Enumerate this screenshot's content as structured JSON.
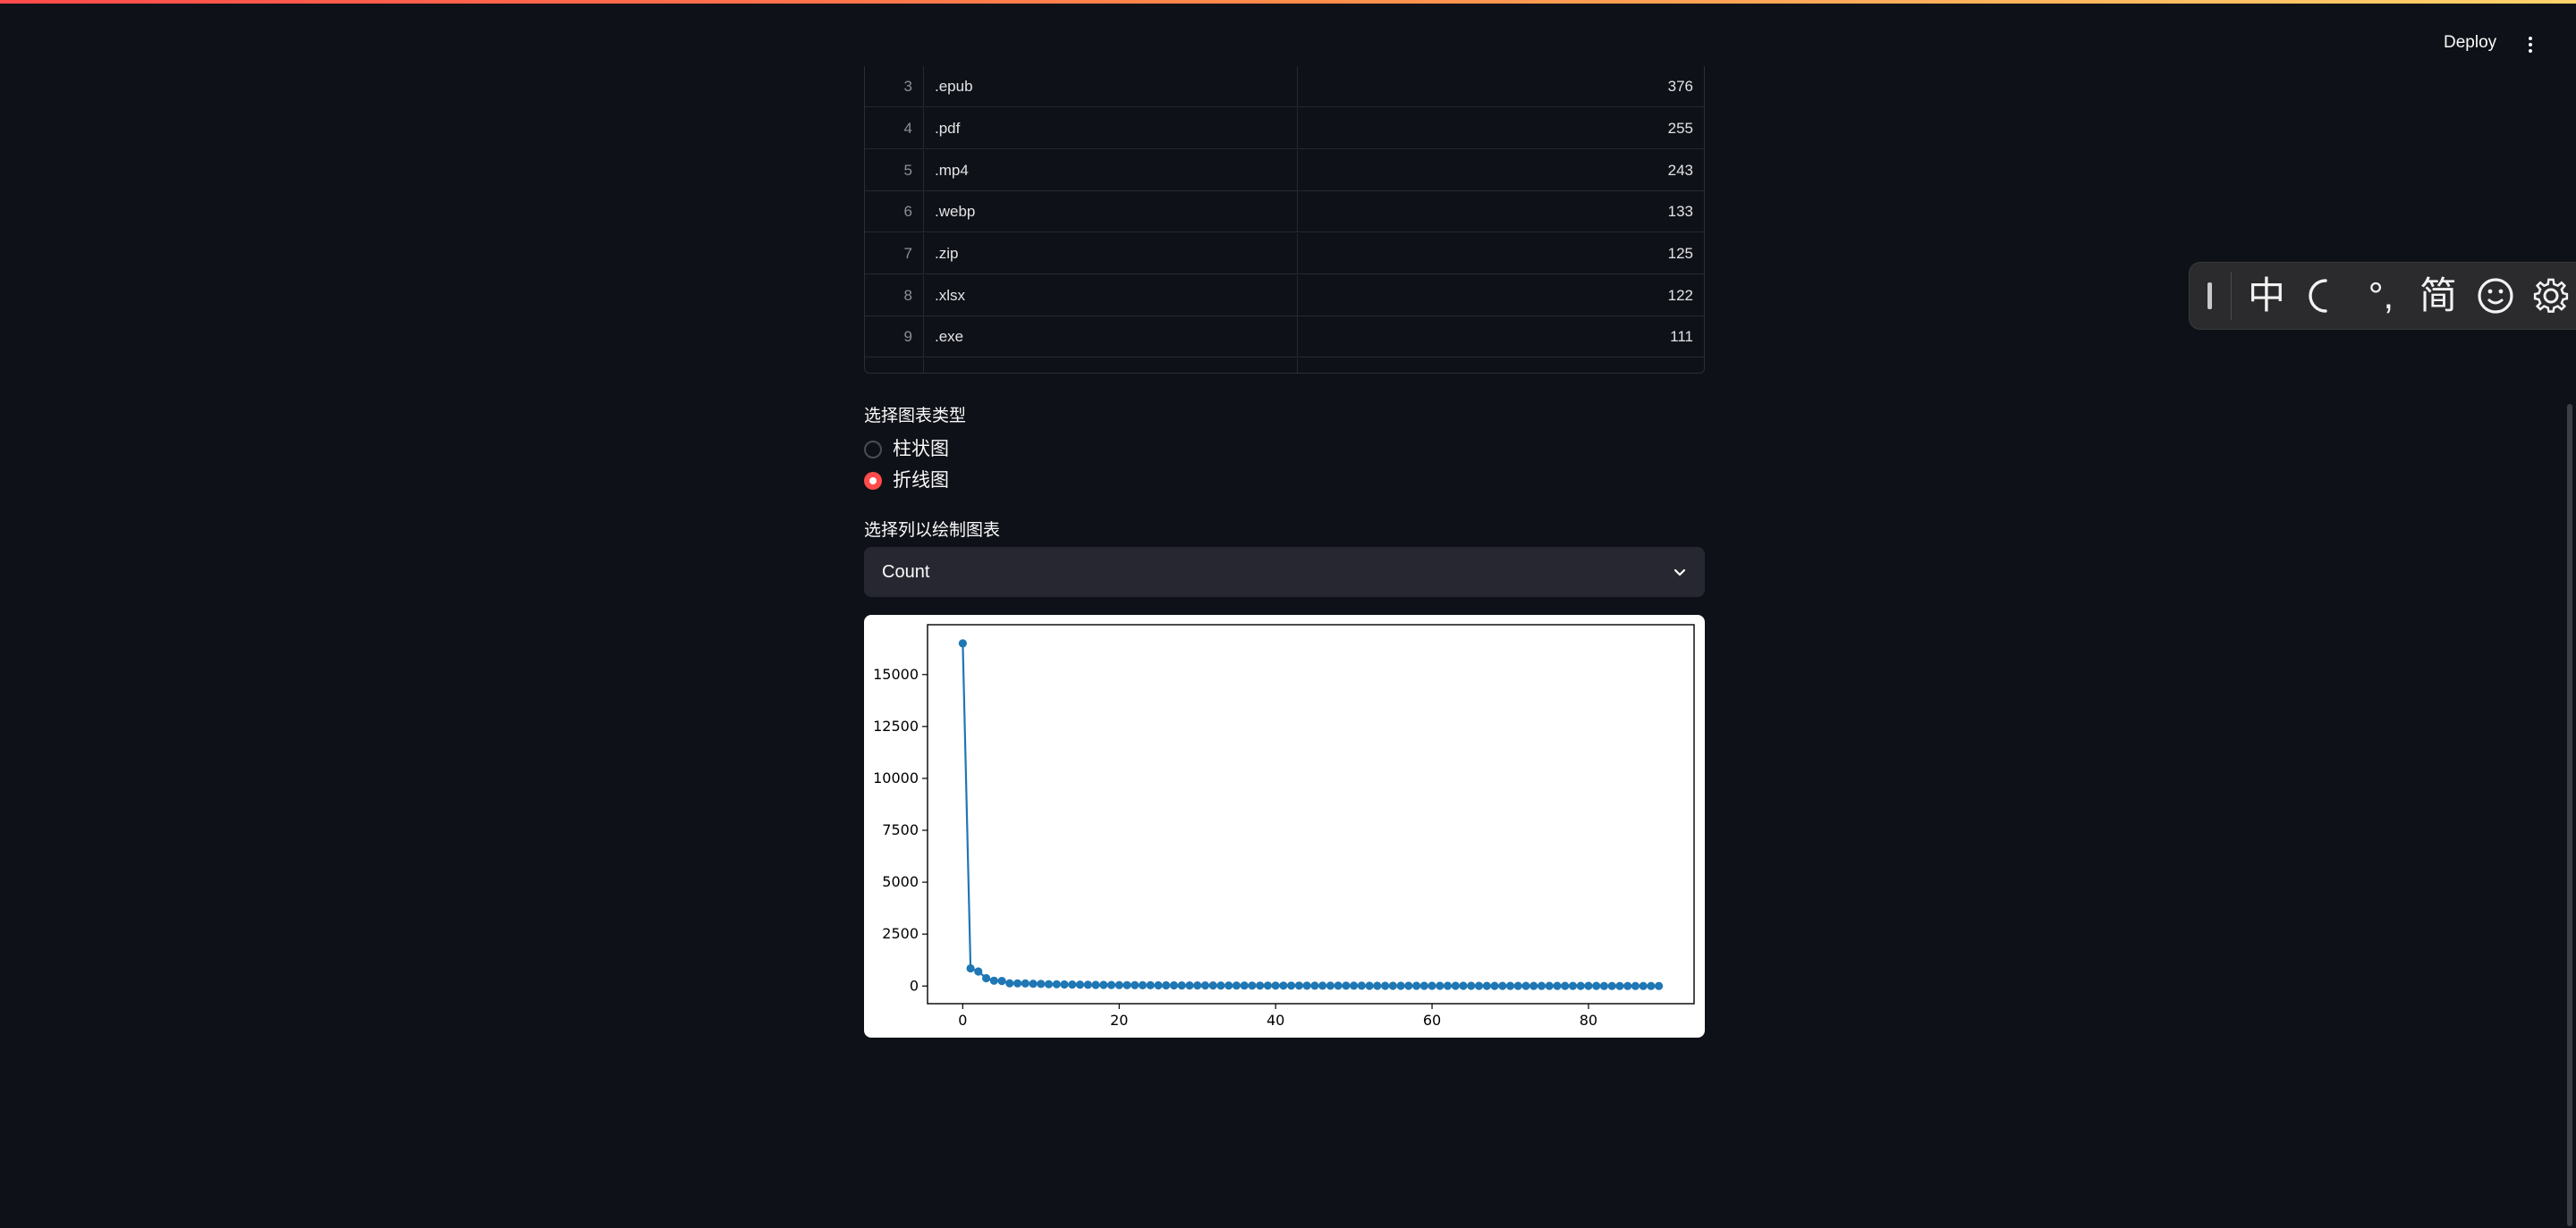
{
  "header": {
    "deploy_label": "Deploy",
    "menu_icon": "kebab-menu-icon"
  },
  "table": {
    "rows": [
      {
        "index": "3",
        "extension": ".epub",
        "count": "376"
      },
      {
        "index": "4",
        "extension": ".pdf",
        "count": "255"
      },
      {
        "index": "5",
        "extension": ".mp4",
        "count": "243"
      },
      {
        "index": "6",
        "extension": ".webp",
        "count": "133"
      },
      {
        "index": "7",
        "extension": ".zip",
        "count": "125"
      },
      {
        "index": "8",
        "extension": ".xlsx",
        "count": "122"
      },
      {
        "index": "9",
        "extension": ".exe",
        "count": "111"
      }
    ]
  },
  "chart_type_selector": {
    "label": "选择图表类型",
    "options": [
      "柱状图",
      "折线图"
    ],
    "selected": "折线图"
  },
  "column_selector": {
    "label": "选择列以绘制图表",
    "value": "Count",
    "chevron_icon": "chevron-down-icon"
  },
  "chart_data": {
    "type": "line",
    "title": "",
    "xlabel": "",
    "ylabel": "",
    "xlim": [
      -4.5,
      93.5
    ],
    "ylim": [
      -850,
      17400
    ],
    "xticks": [
      "0",
      "20",
      "40",
      "60",
      "80"
    ],
    "yticks": [
      "0",
      "2500",
      "5000",
      "7500",
      "10000",
      "12500",
      "15000"
    ],
    "grid": false,
    "marker": "circle",
    "series": [
      {
        "color": "#1f77b4",
        "x": [
          0,
          1,
          2,
          3,
          4,
          5,
          6,
          7,
          8,
          9,
          10,
          11,
          12,
          13,
          14,
          15,
          16,
          17,
          18,
          19,
          20,
          21,
          22,
          23,
          24,
          25,
          26,
          27,
          28,
          29,
          30,
          31,
          32,
          33,
          34,
          35,
          36,
          37,
          38,
          39,
          40,
          41,
          42,
          43,
          44,
          45,
          46,
          47,
          48,
          49,
          50,
          51,
          52,
          53,
          54,
          55,
          56,
          57,
          58,
          59,
          60,
          61,
          62,
          63,
          64,
          65,
          66,
          67,
          68,
          69,
          70,
          71,
          72,
          73,
          74,
          75,
          76,
          77,
          78,
          79,
          80,
          81,
          82,
          83,
          84,
          85,
          86,
          87,
          88,
          89
        ],
        "y": [
          16500,
          850,
          700,
          376,
          255,
          243,
          133,
          125,
          122,
          111,
          100,
          90,
          82,
          75,
          70,
          65,
          60,
          56,
          52,
          48,
          45,
          42,
          40,
          38,
          36,
          34,
          32,
          31,
          30,
          29,
          28,
          27,
          26,
          25,
          24,
          23,
          22,
          21,
          20,
          20,
          19,
          19,
          18,
          18,
          17,
          17,
          16,
          16,
          15,
          15,
          14,
          14,
          13,
          13,
          12,
          12,
          12,
          11,
          11,
          11,
          10,
          10,
          10,
          9,
          9,
          9,
          8,
          8,
          8,
          8,
          7,
          7,
          7,
          7,
          6,
          6,
          6,
          6,
          5,
          5,
          5,
          5,
          4,
          4,
          4,
          4,
          3,
          3,
          3,
          2
        ]
      }
    ]
  },
  "ime_toolbar": {
    "items": [
      "中",
      "☽",
      "°,",
      "简",
      "☺",
      "⚙"
    ]
  }
}
